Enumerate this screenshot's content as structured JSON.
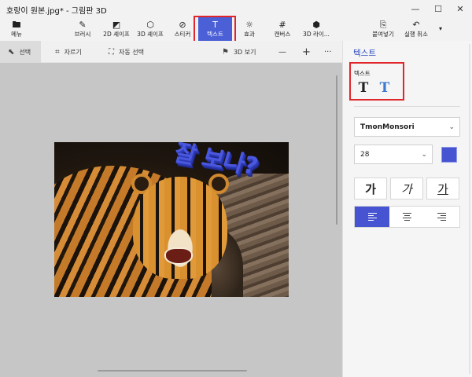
{
  "window": {
    "title": "호랑이 원본.jpg* - 그림판 3D",
    "controls": {
      "minimize": "—",
      "maximize": "☐",
      "close": "✕"
    }
  },
  "ribbon": {
    "menu": {
      "label": "메뉴",
      "icon": "folder-icon"
    },
    "tools": [
      {
        "id": "brush",
        "label": "브러시",
        "icon": "brush-icon"
      },
      {
        "id": "2d",
        "label": "2D 셰이프",
        "icon": "2d-shapes-icon"
      },
      {
        "id": "3d",
        "label": "3D 셰이프",
        "icon": "3d-shapes-icon"
      },
      {
        "id": "sticker",
        "label": "스티커",
        "icon": "sticker-icon"
      },
      {
        "id": "text",
        "label": "텍스트",
        "icon": "text-icon",
        "active": true
      },
      {
        "id": "effects",
        "label": "효과",
        "icon": "effects-icon"
      },
      {
        "id": "canvas",
        "label": "캔버스",
        "icon": "canvas-icon"
      },
      {
        "id": "3dlib",
        "label": "3D 라이...",
        "icon": "3d-library-icon"
      }
    ],
    "paste": {
      "label": "붙여넣기",
      "icon": "paste-icon"
    },
    "undo": {
      "label": "실행 취소",
      "icon": "undo-icon"
    }
  },
  "subbar": {
    "select": "선택",
    "crop": "자르기",
    "magic_select": "자동 선택",
    "view3d": "3D 보기",
    "zoom_out": "—",
    "zoom_in": "+",
    "more": "···"
  },
  "canvas": {
    "overlay_text": "잘 보나?"
  },
  "panel": {
    "title": "텍스트",
    "text_type_label": "텍스트",
    "text_2d_glyph": "T",
    "text_3d_glyph": "T",
    "font": "TmonMonsori",
    "size": "28",
    "color": "#4654d2",
    "style_bold": "가",
    "style_italic": "가",
    "style_underline": "가",
    "alignment": [
      "left",
      "center",
      "right"
    ],
    "active_alignment": "left"
  }
}
